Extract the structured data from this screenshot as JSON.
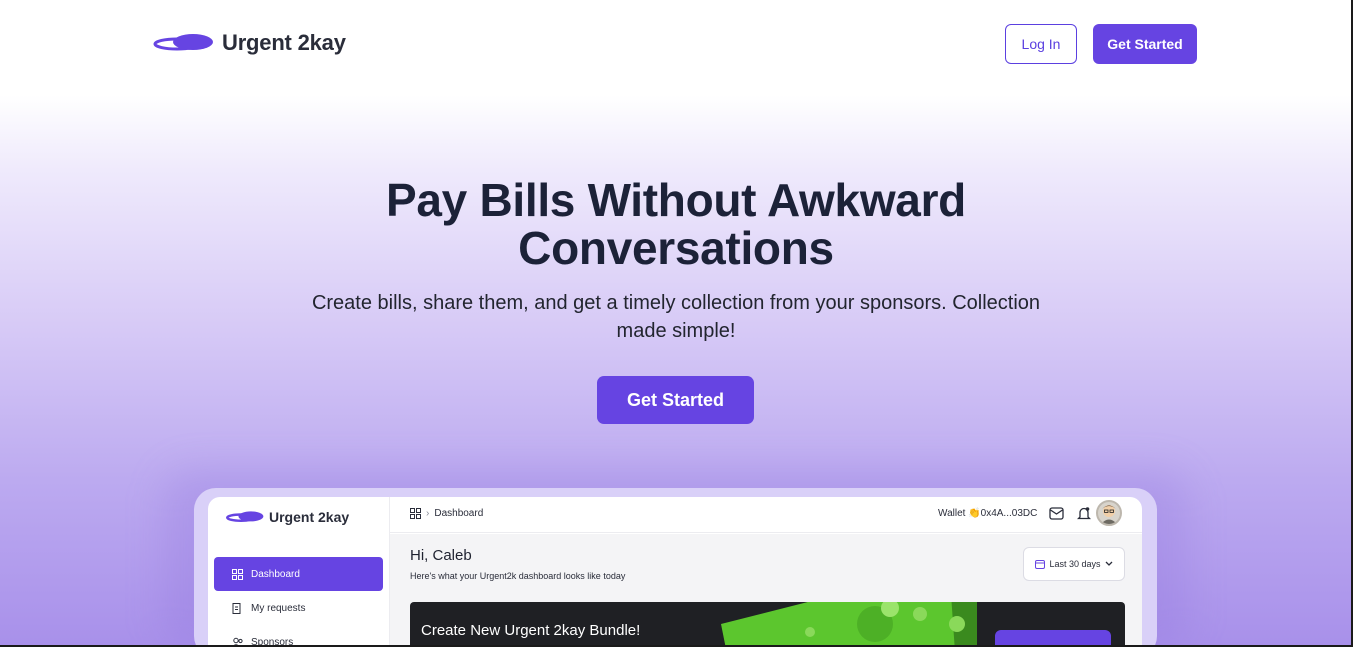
{
  "nav": {
    "brand": "Urgent 2kay",
    "login_label": "Log In",
    "get_started_label": "Get Started"
  },
  "hero": {
    "title": "Pay Bills Without Awkward Conversations",
    "subtitle": "Create bills, share them, and get a timely collection from your sponsors. Collection made simple!",
    "cta_label": "Get Started"
  },
  "preview": {
    "brand": "Urgent 2kay",
    "breadcrumb": "Dashboard",
    "wallet": "Wallet 👏0x4A...03DC",
    "sidebar": {
      "items": [
        {
          "label": "Dashboard",
          "icon": "grid-icon"
        },
        {
          "label": "My requests",
          "icon": "document-icon"
        },
        {
          "label": "Sponsors",
          "icon": "users-icon"
        }
      ]
    },
    "greeting": "Hi, Caleb",
    "greeting_sub": "Here's what your Urgent2k dashboard looks like today",
    "date_range": "Last 30 days",
    "banner_text": "Create New Urgent 2kay Bundle!"
  },
  "colors": {
    "accent": "#6644e2",
    "heading": "#1c2238",
    "banner_bg": "#1f2024"
  }
}
